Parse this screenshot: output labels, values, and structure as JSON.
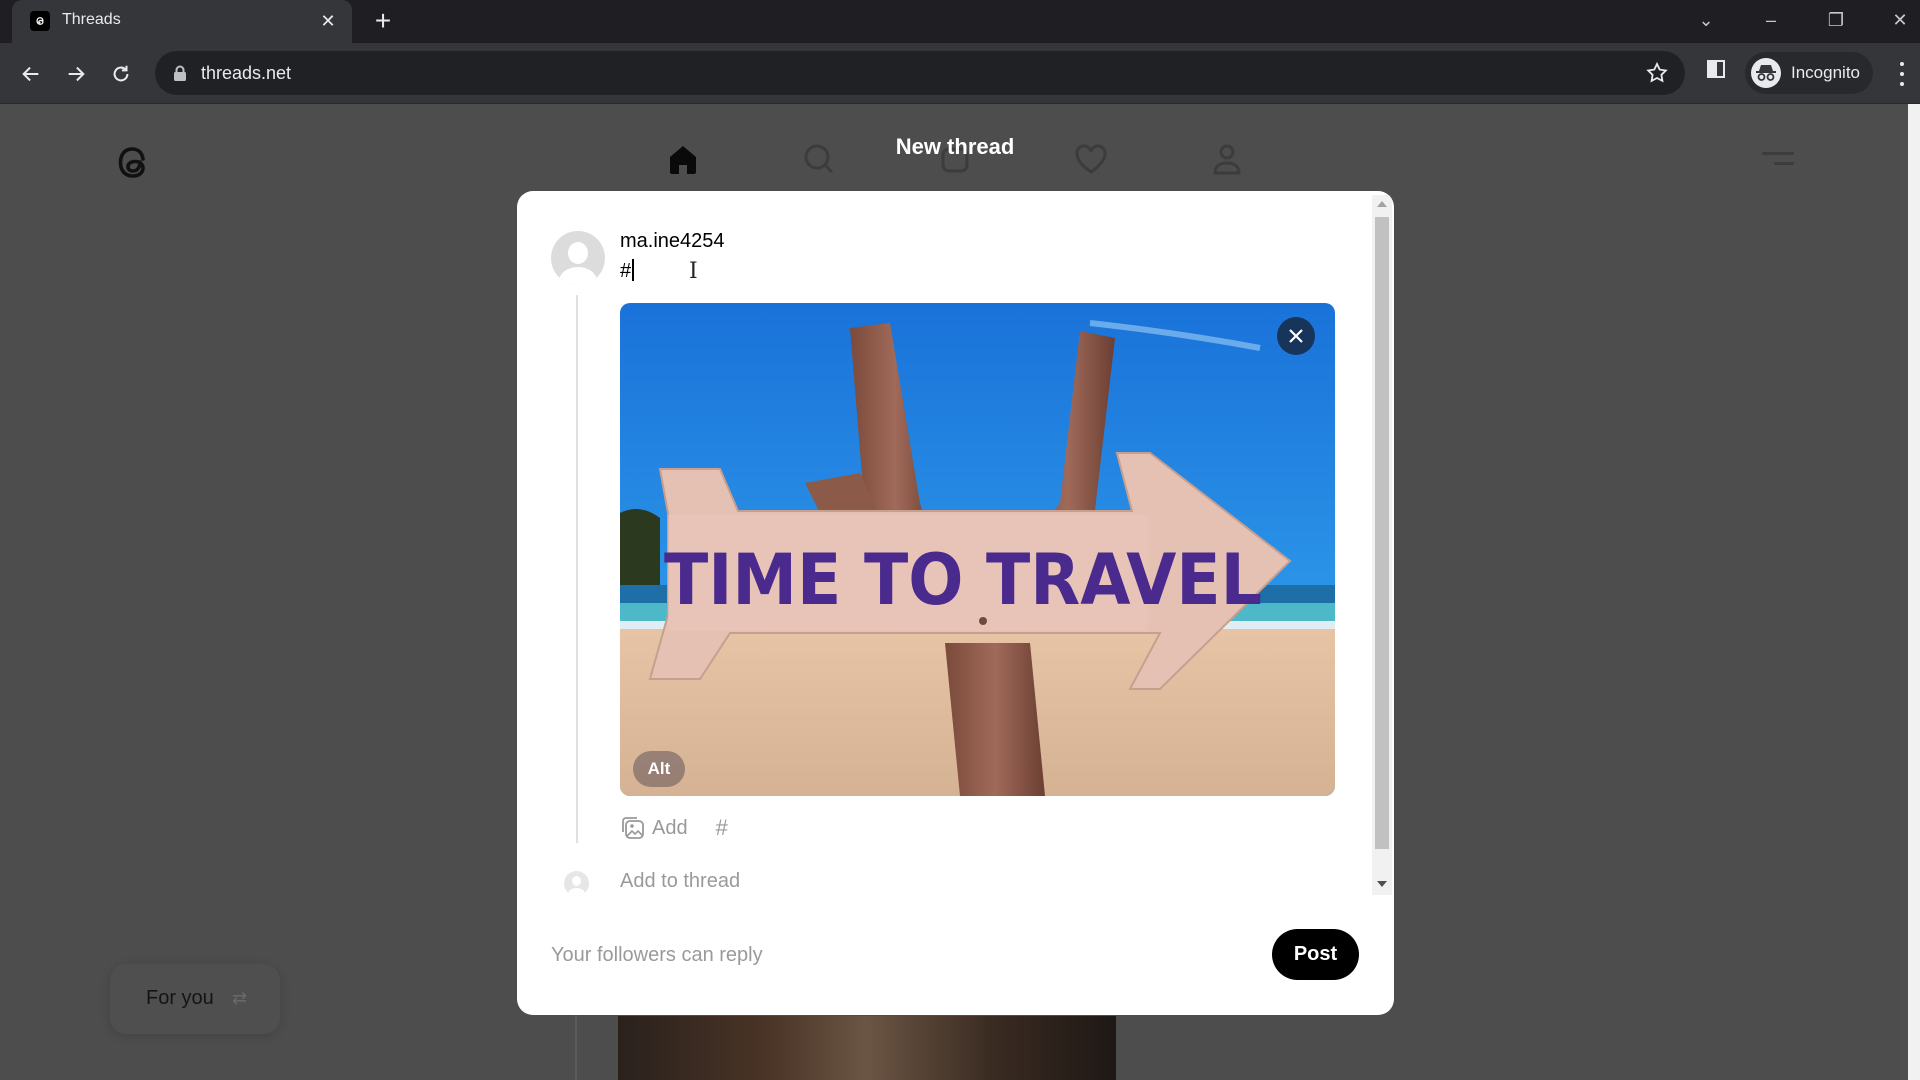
{
  "browser": {
    "tab": {
      "title": "Threads",
      "close_glyph": "✕"
    },
    "new_tab_glyph": "+",
    "url": "threads.net",
    "profile_label": "Incognito",
    "window_controls": {
      "tab_search": "⌄",
      "minimize": "–",
      "restore": "❐",
      "close": "✕"
    }
  },
  "page": {
    "top_nav": [
      "home-icon",
      "search-icon",
      "compose-icon",
      "heart-icon",
      "profile-icon"
    ],
    "feed_switcher": {
      "label": "For you",
      "icon": "⇄"
    }
  },
  "modal": {
    "title": "New thread",
    "username": "ma.ine4254",
    "compose_text": "#",
    "media": {
      "sign_text": "TIME TO TRAVEL",
      "alt_label": "Alt",
      "close_glyph": "✕"
    },
    "attach": {
      "add_label": "Add",
      "hashtag_glyph": "#"
    },
    "add_to_thread": "Add to thread",
    "reply_setting": "Your followers can reply",
    "post_label": "Post"
  },
  "colors": {
    "overlay_bg": "#4d4d4d",
    "modal_bg": "#ffffff",
    "post_button": "#000000",
    "muted_text": "#9a9a9a",
    "sign_text": "#4b2a8e",
    "media_close_bg": "#17345a"
  }
}
